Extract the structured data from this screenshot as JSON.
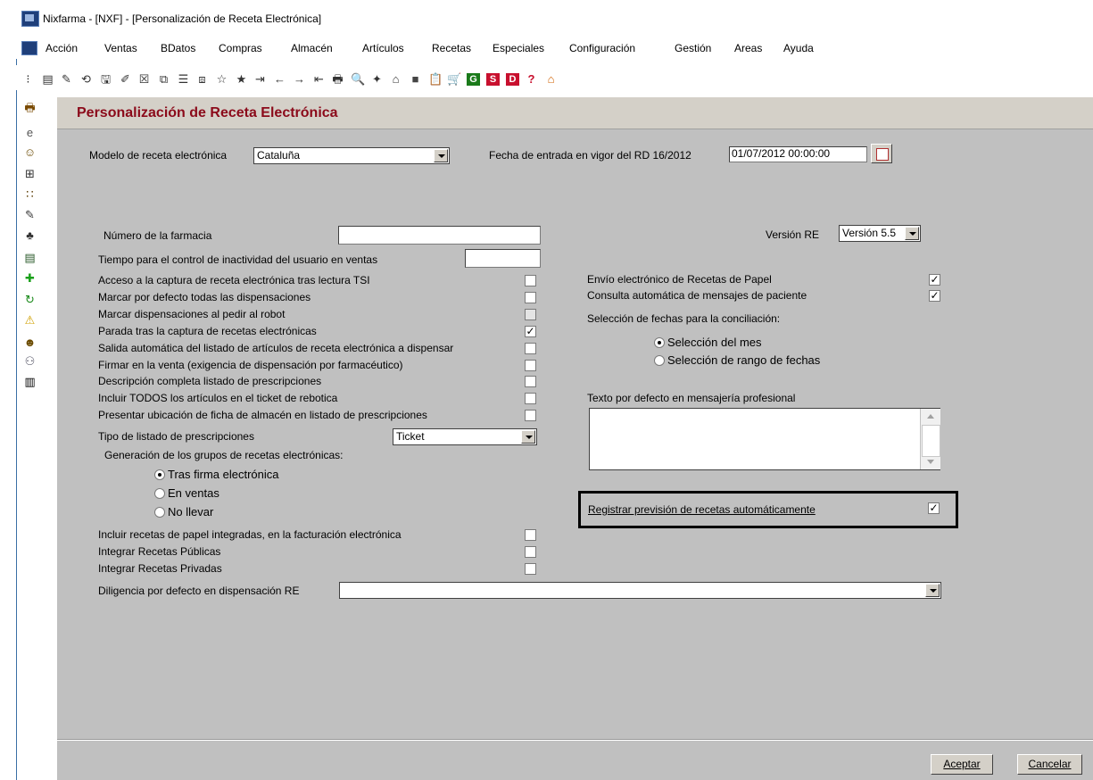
{
  "window": {
    "title": "Nixfarma - [NXF] - [Personalización de Receta Electrónica]"
  },
  "menu": [
    "Acción",
    "Ventas",
    "BDatos",
    "Compras",
    "Almacén",
    "Artículos",
    "Recetas",
    "Especiales",
    "Configuración",
    "Gestión",
    "Areas",
    "Ayuda"
  ],
  "page": {
    "title": "Personalización de Receta Electrónica"
  },
  "form": {
    "modelo_label": "Modelo de receta electrónica",
    "modelo_value": "Cataluña",
    "fecha_label": "Fecha de entrada en vigor del RD 16/2012",
    "fecha_value": "01/07/2012 00:00:00",
    "numero_farmacia_label": "Número de la farmacia",
    "numero_farmacia_value": "",
    "tiempo_label": "Tiempo para el control de inactividad del usuario en ventas",
    "tiempo_value": "",
    "version_label": "Versión RE",
    "version_value": "Versión 5.5",
    "checks_left": [
      {
        "label": "Acceso a la captura de receta electrónica tras lectura TSI",
        "checked": false,
        "grey": false
      },
      {
        "label": "Marcar por defecto todas las dispensaciones",
        "checked": false,
        "grey": false
      },
      {
        "label": "Marcar dispensaciones al pedir al robot",
        "checked": false,
        "grey": true
      },
      {
        "label": "Parada tras la captura de recetas electrónicas",
        "checked": true,
        "grey": false
      },
      {
        "label": "Salida automática del listado de artículos de receta electrónica a dispensar",
        "checked": false,
        "grey": false
      },
      {
        "label": "Firmar en la venta (exigencia de dispensación por farmacéutico)",
        "checked": false,
        "grey": false
      },
      {
        "label": "Descripción completa listado de prescripciones",
        "checked": false,
        "grey": false
      },
      {
        "label": "Incluir TODOS los artículos en el ticket de rebotica",
        "checked": false,
        "grey": false
      },
      {
        "label": "Presentar ubicación de ficha de almacén en listado de prescripciones",
        "checked": false,
        "grey": false
      }
    ],
    "tipo_listado_label": "Tipo de listado de prescripciones",
    "tipo_listado_value": "Ticket",
    "generacion_label": "Generación de los grupos de recetas electrónicas:",
    "generacion_options": [
      {
        "label": "Tras firma electrónica",
        "selected": true
      },
      {
        "label": "En ventas",
        "selected": false
      },
      {
        "label": "No llevar",
        "selected": false
      }
    ],
    "checks_bottom": [
      {
        "label": "Incluir recetas de papel integradas, en la facturación electrónica",
        "checked": false
      },
      {
        "label": "Integrar Recetas Públicas",
        "checked": false
      },
      {
        "label": "Integrar Recetas Privadas",
        "checked": false
      }
    ],
    "diligencia_label": "Diligencia por defecto en dispensación RE",
    "diligencia_value": "",
    "checks_right": [
      {
        "label": "Envío electrónico de Recetas de Papel",
        "checked": true
      },
      {
        "label": "Consulta automática de mensajes de paciente",
        "checked": true
      }
    ],
    "seleccion_label": "Selección de fechas para la conciliación:",
    "seleccion_options": [
      {
        "label": "Selección del mes",
        "selected": true
      },
      {
        "label": "Selección de rango de fechas",
        "selected": false
      }
    ],
    "texto_label": "Texto por defecto en mensajería profesional",
    "texto_value": "",
    "registrar_label": "Registrar previsión de recetas automáticamente",
    "registrar_checked": true
  },
  "buttons": {
    "aceptar": "Aceptar",
    "cancelar": "Cancelar"
  },
  "toolbar_icons": [
    "grip-icon",
    "notes-icon",
    "edit-icon",
    "cycle-icon",
    "save-icon",
    "edit2-icon",
    "delete-icon",
    "filter-icon",
    "list-icon",
    "copy-icon",
    "star-outline-icon",
    "star-icon",
    "exit-icon",
    "arrow-left-icon",
    "arrow-right-icon",
    "import-icon",
    "printer-icon",
    "zoom-icon",
    "magic-icon",
    "home-icon",
    "stop-icon",
    "clipboard-icon",
    "cart-icon",
    "g-icon",
    "s-icon",
    "d-icon",
    "help-icon",
    "home-red-icon"
  ],
  "toolbar_glyphs": [
    "⁝",
    "▤",
    "✎",
    "⟲",
    "🖫",
    "✐",
    "☒",
    "⧉",
    "☰",
    "⧈",
    "☆",
    "★",
    "⇥",
    "←",
    "→",
    "⇤",
    "🖶",
    "🔍",
    "✦",
    "⌂",
    "■",
    "📋",
    "🛒",
    "G",
    "S",
    "D",
    "?",
    "⌂"
  ],
  "sidebar_icons": [
    "printer-icon",
    "eye-icon",
    "person-icon",
    "cart-icon",
    "pills-icon",
    "syringe-icon",
    "people-icon",
    "register-icon",
    "plus-icon",
    "refresh-icon",
    "warning-icon",
    "user-icon",
    "group-icon",
    "barcode-icon"
  ],
  "sidebar_glyphs": [
    "🖶",
    "e",
    "☺",
    "⊞",
    "∷",
    "✎",
    "♣",
    "▤",
    "✚",
    "↻",
    "⚠",
    "☻",
    "⚇",
    "▥"
  ]
}
